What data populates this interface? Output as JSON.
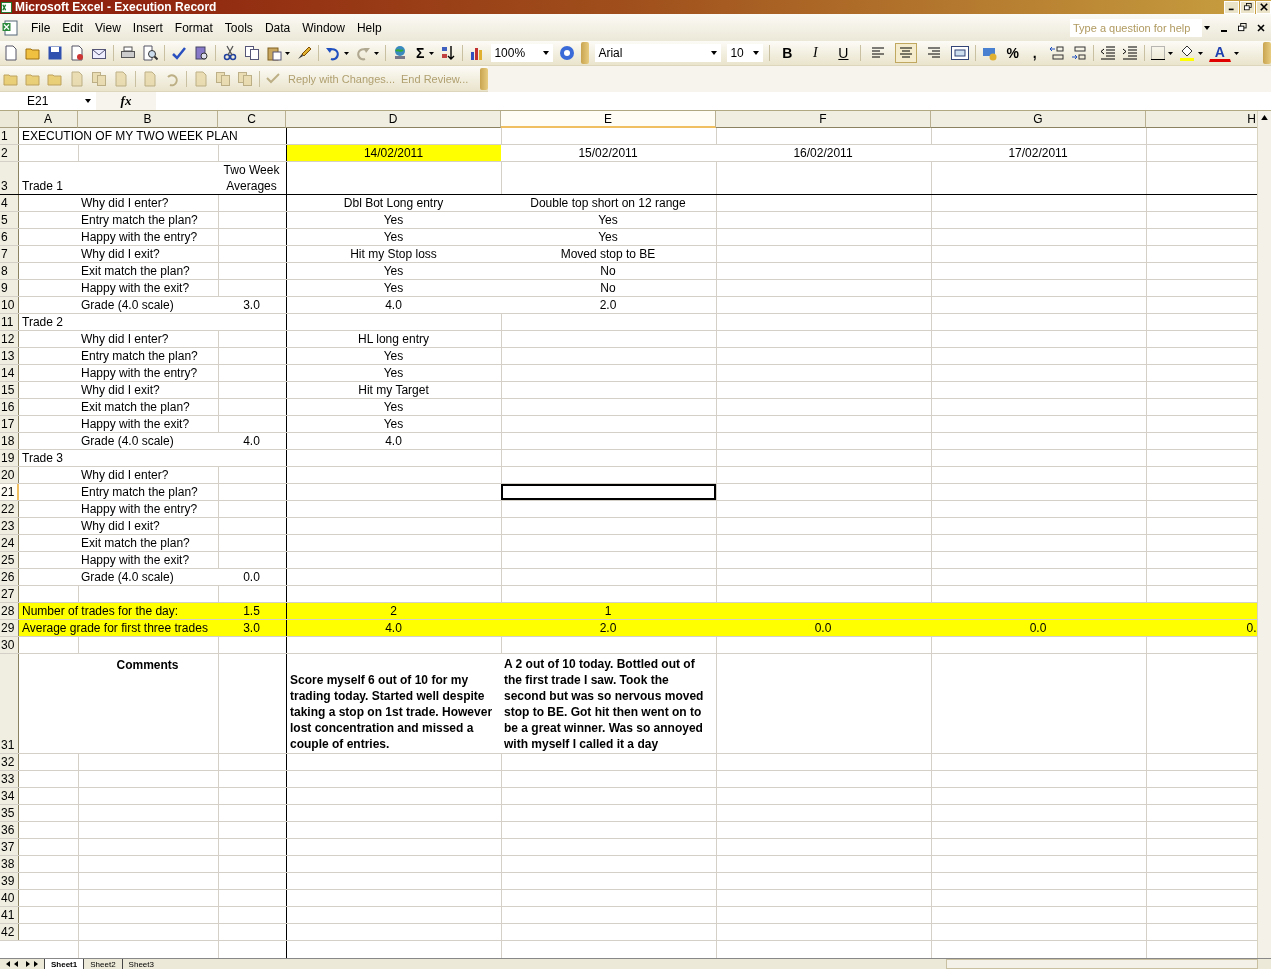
{
  "window": {
    "title": "Microsoft Excel - Execution Record"
  },
  "menu": [
    {
      "label": "File"
    },
    {
      "label": "Edit"
    },
    {
      "label": "View"
    },
    {
      "label": "Insert"
    },
    {
      "label": "Format"
    },
    {
      "label": "Tools"
    },
    {
      "label": "Data"
    },
    {
      "label": "Window"
    },
    {
      "label": "Help"
    }
  ],
  "help_box": {
    "placeholder": "Type a question for help"
  },
  "standard_toolbar": {
    "sum": "Σ",
    "zoom": "100%"
  },
  "formatting_toolbar": {
    "font": "Arial",
    "size": "10",
    "bold": "B",
    "italic": "I",
    "underline": "U",
    "alignment": [
      {
        "selected": false
      },
      {
        "selected": true
      },
      {
        "selected": false
      }
    ],
    "percent": "%",
    "comma": ",",
    "font_color": "A"
  },
  "reviewing_toolbar": {
    "reply": "Reply with Changes...",
    "end_review": "End Review..."
  },
  "formula_bar": {
    "name_box": "E21",
    "fx": "fx"
  },
  "columns": [
    {
      "label": "A",
      "selected": false
    },
    {
      "label": "B",
      "selected": false
    },
    {
      "label": "C",
      "selected": false
    },
    {
      "label": "D",
      "selected": false
    },
    {
      "label": "E",
      "selected": true
    },
    {
      "label": "F",
      "selected": false
    },
    {
      "label": "G",
      "selected": false
    },
    {
      "label": "H",
      "selected": false
    }
  ],
  "rows": [
    {
      "label": "1",
      "selected": false,
      "highlighted": false,
      "cells": {
        "A": {
          "text": "EXECUTION OF MY TWO WEEK PLAN"
        }
      }
    },
    {
      "label": "2",
      "selected": false,
      "highlighted": false,
      "cells": {
        "D": {
          "text": "14/02/2011",
          "highlighted": true
        },
        "E": {
          "text": "15/02/2011"
        },
        "F": {
          "text": "16/02/2011"
        },
        "G": {
          "text": "17/02/2011"
        }
      }
    },
    {
      "label": "3",
      "selected": false,
      "highlighted": false,
      "cells": {
        "A": {
          "text": "Trade 1"
        },
        "C": {
          "text": "Two Week Averages"
        }
      }
    },
    {
      "label": "4",
      "selected": false,
      "highlighted": false,
      "cells": {
        "B": {
          "text": "Why did I enter?"
        },
        "D": {
          "text": "Dbl Bot Long entry"
        },
        "E": {
          "text": "Double top short on 12 range"
        }
      }
    },
    {
      "label": "5",
      "selected": false,
      "highlighted": false,
      "cells": {
        "B": {
          "text": "Entry match the plan?"
        },
        "D": {
          "text": "Yes"
        },
        "E": {
          "text": "Yes"
        }
      }
    },
    {
      "label": "6",
      "selected": false,
      "highlighted": false,
      "cells": {
        "B": {
          "text": "Happy with the entry?"
        },
        "D": {
          "text": "Yes"
        },
        "E": {
          "text": "Yes"
        }
      }
    },
    {
      "label": "7",
      "selected": false,
      "highlighted": false,
      "cells": {
        "B": {
          "text": "Why did I exit?"
        },
        "D": {
          "text": "Hit my Stop loss"
        },
        "E": {
          "text": "Moved stop to BE"
        }
      }
    },
    {
      "label": "8",
      "selected": false,
      "highlighted": false,
      "cells": {
        "B": {
          "text": "Exit match the plan?"
        },
        "D": {
          "text": "Yes"
        },
        "E": {
          "text": "No"
        }
      }
    },
    {
      "label": "9",
      "selected": false,
      "highlighted": false,
      "cells": {
        "B": {
          "text": "Happy with the exit?"
        },
        "D": {
          "text": "Yes"
        },
        "E": {
          "text": "No"
        }
      }
    },
    {
      "label": "10",
      "selected": false,
      "highlighted": false,
      "cells": {
        "B": {
          "text": "Grade (4.0 scale)"
        },
        "C": {
          "text": "3.0"
        },
        "D": {
          "text": "4.0"
        },
        "E": {
          "text": "2.0"
        }
      }
    },
    {
      "label": "11",
      "selected": false,
      "highlighted": false,
      "cells": {
        "A": {
          "text": "Trade 2"
        }
      }
    },
    {
      "label": "12",
      "selected": false,
      "highlighted": false,
      "cells": {
        "B": {
          "text": "Why did I enter?"
        },
        "D": {
          "text": "HL long entry"
        }
      }
    },
    {
      "label": "13",
      "selected": false,
      "highlighted": false,
      "cells": {
        "B": {
          "text": "Entry match the plan?"
        },
        "D": {
          "text": "Yes"
        }
      }
    },
    {
      "label": "14",
      "selected": false,
      "highlighted": false,
      "cells": {
        "B": {
          "text": "Happy with the entry?"
        },
        "D": {
          "text": "Yes"
        }
      }
    },
    {
      "label": "15",
      "selected": false,
      "highlighted": false,
      "cells": {
        "B": {
          "text": "Why did I exit?"
        },
        "D": {
          "text": "Hit my Target"
        }
      }
    },
    {
      "label": "16",
      "selected": false,
      "highlighted": false,
      "cells": {
        "B": {
          "text": "Exit match the plan?"
        },
        "D": {
          "text": "Yes"
        }
      }
    },
    {
      "label": "17",
      "selected": false,
      "highlighted": false,
      "cells": {
        "B": {
          "text": "Happy with the exit?"
        },
        "D": {
          "text": "Yes"
        }
      }
    },
    {
      "label": "18",
      "selected": false,
      "highlighted": false,
      "cells": {
        "B": {
          "text": "Grade (4.0 scale)"
        },
        "C": {
          "text": "4.0"
        },
        "D": {
          "text": "4.0"
        }
      }
    },
    {
      "label": "19",
      "selected": false,
      "highlighted": false,
      "cells": {
        "A": {
          "text": "Trade 3"
        }
      }
    },
    {
      "label": "20",
      "selected": false,
      "highlighted": false,
      "cells": {
        "B": {
          "text": "Why did I enter?"
        }
      }
    },
    {
      "label": "21",
      "selected": true,
      "highlighted": false,
      "cells": {
        "B": {
          "text": "Entry match the plan?"
        },
        "E": {
          "selected": true
        }
      }
    },
    {
      "label": "22",
      "selected": false,
      "highlighted": false,
      "cells": {
        "B": {
          "text": "Happy with the entry?"
        }
      }
    },
    {
      "label": "23",
      "selected": false,
      "highlighted": false,
      "cells": {
        "B": {
          "text": "Why did I exit?"
        }
      }
    },
    {
      "label": "24",
      "selected": false,
      "highlighted": false,
      "cells": {
        "B": {
          "text": "Exit match the plan?"
        }
      }
    },
    {
      "label": "25",
      "selected": false,
      "highlighted": false,
      "cells": {
        "B": {
          "text": "Happy with the exit?"
        }
      }
    },
    {
      "label": "26",
      "selected": false,
      "highlighted": false,
      "cells": {
        "B": {
          "text": "Grade (4.0 scale)"
        },
        "C": {
          "text": "0.0"
        }
      }
    },
    {
      "label": "27",
      "selected": false,
      "highlighted": false
    },
    {
      "label": "28",
      "selected": false,
      "highlighted": true,
      "cells": {
        "A": {
          "text": "Number of trades for the day:"
        },
        "C": {
          "text": "1.5"
        },
        "D": {
          "text": "2"
        },
        "E": {
          "text": "1"
        }
      }
    },
    {
      "label": "29",
      "selected": false,
      "highlighted": true,
      "cells": {
        "A": {
          "text": "Average grade for first three trades"
        },
        "C": {
          "text": "3.0"
        },
        "D": {
          "text": "4.0"
        },
        "E": {
          "text": "2.0"
        },
        "F": {
          "text": "0.0"
        },
        "G": {
          "text": "0.0"
        },
        "H": {
          "text": "0."
        }
      }
    },
    {
      "label": "30",
      "selected": false,
      "highlighted": false
    },
    {
      "label": "31",
      "kind": "comments",
      "selected": false,
      "highlighted": false,
      "cells": {
        "B": {
          "text": "Comments"
        },
        "D": {
          "text": "Score myself 6 out of 10 for my trading today. Started well despite taking a stop on 1st trade. However lost concentration and missed a couple of entries."
        },
        "E": {
          "text": "A 2 out of 10 today. Bottled out of the first trade I saw. Took the second but was so nervous moved stop to BE. Got hit then went on to be a great winner. Was so annoyed with myself I called it a day"
        }
      }
    },
    {
      "label": "32",
      "selected": false,
      "highlighted": false
    },
    {
      "label": "33",
      "selected": false,
      "highlighted": false
    },
    {
      "label": "34",
      "selected": false,
      "highlighted": false
    },
    {
      "label": "35",
      "selected": false,
      "highlighted": false
    },
    {
      "label": "36",
      "selected": false,
      "highlighted": false
    },
    {
      "label": "37",
      "selected": false,
      "highlighted": false
    },
    {
      "label": "38",
      "selected": false,
      "highlighted": false
    },
    {
      "label": "39",
      "selected": false,
      "highlighted": false
    },
    {
      "label": "40",
      "selected": false,
      "highlighted": false
    },
    {
      "label": "41",
      "selected": false,
      "highlighted": false
    },
    {
      "label": "42",
      "selected": false,
      "highlighted": false
    }
  ],
  "sheet_tabs": [
    {
      "label": "Sheet1",
      "selected": true
    },
    {
      "label": "Sheet2",
      "selected": false
    },
    {
      "label": "Sheet3",
      "selected": false
    }
  ]
}
